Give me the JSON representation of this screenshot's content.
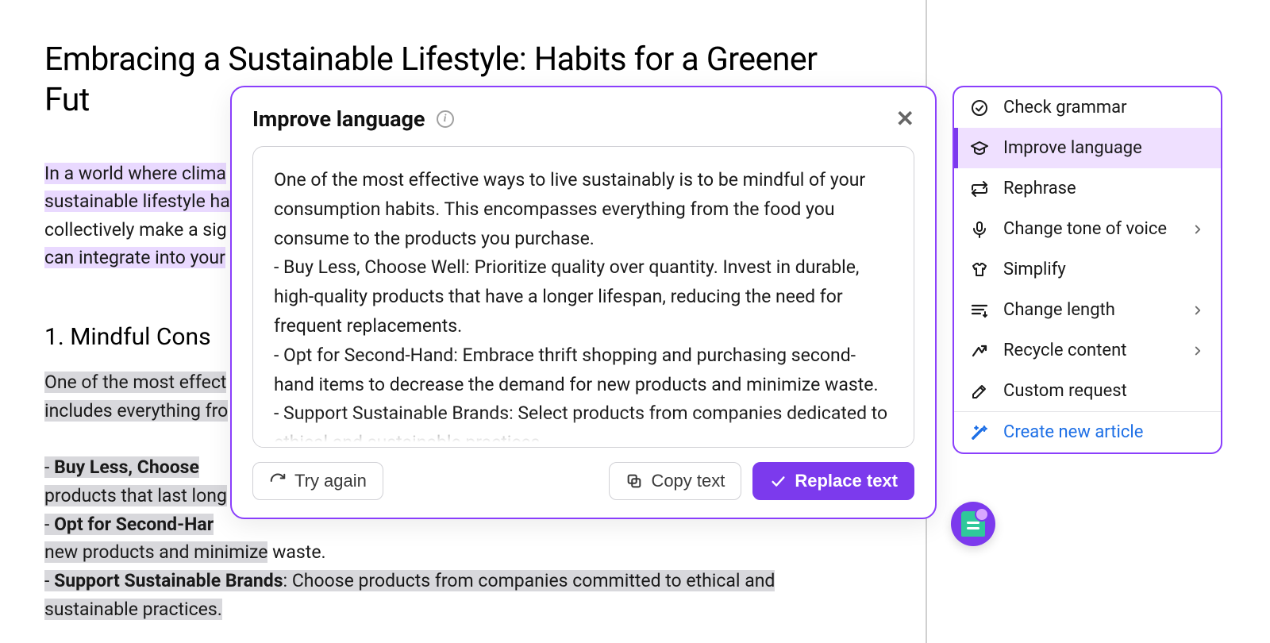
{
  "doc": {
    "title": "Embracing a Sustainable Lifestyle: Habits for a Greener Fut",
    "intro": {
      "line1_hl": "In a world where clima",
      "line2_hl": "sustainable lifestyle ha",
      "line3_plain": "collectively make a sig",
      "line4_hl": "can integrate into your"
    },
    "section1": {
      "heading": "1. Mindful Cons",
      "p1a": "One of the most effect",
      "p1b": "includes everything fro",
      "b1_bold": "Buy Less, Choose ",
      "b1_tail": "products that last long",
      "b2_bold": "Opt for Second-Har",
      "b2_tail_a": "new products and minimize",
      "b2_tail_b": " waste.",
      "b3_bold": "Support Sustainable Brands",
      "b3_rest_a": ": Choose products from companies committed to ethical and",
      "b3_rest_b": "sustainable practices."
    }
  },
  "popup": {
    "title": "Improve language",
    "suggestion": "One of the most effective ways to live sustainably is to be mindful of your consumption habits. This encompasses everything from the food you consume to the products you purchase.\n- Buy Less, Choose Well: Prioritize quality over quantity. Invest in durable, high-quality products that have a longer lifespan, reducing the need for frequent replacements.\n- Opt for Second-Hand: Embrace thrift shopping and purchasing second-hand items to decrease the demand for new products and minimize waste.\n- Support Sustainable Brands: Select products from companies dedicated to ethical and sustainable practices",
    "try_again": "Try again",
    "copy_text": "Copy text",
    "replace_text": "Replace text"
  },
  "menu": {
    "check_grammar": "Check grammar",
    "improve_language": "Improve language",
    "rephrase": "Rephrase",
    "change_tone": "Change tone of voice",
    "simplify": "Simplify",
    "change_length": "Change length",
    "recycle_content": "Recycle content",
    "custom_request": "Custom request",
    "create_new_article": "Create new article"
  }
}
